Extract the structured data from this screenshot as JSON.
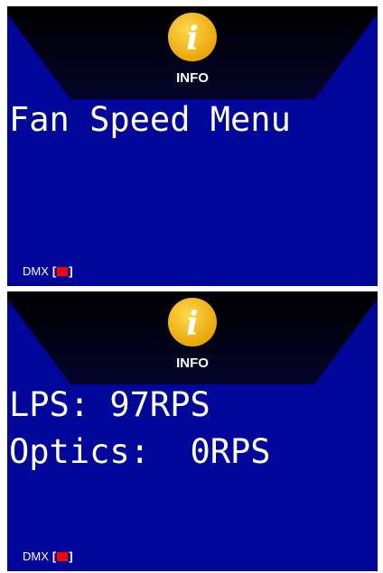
{
  "colors": {
    "screen_bg": "#00069a",
    "header_bg": "#000000",
    "icon_gold": "#f6b800",
    "dmx_indicator": "#ff0000"
  },
  "screens": [
    {
      "header": {
        "icon": "info-icon",
        "label": "INFO"
      },
      "lines": [
        "Fan Speed Menu"
      ],
      "status": {
        "label": "DMX",
        "open_bracket": "[",
        "close_bracket": "]",
        "indicator": "red"
      }
    },
    {
      "header": {
        "icon": "info-icon",
        "label": "INFO"
      },
      "lines": [
        "LPS: 97RPS",
        "Optics:  0RPS"
      ],
      "status": {
        "label": "DMX",
        "open_bracket": "[",
        "close_bracket": "]",
        "indicator": "red"
      }
    }
  ]
}
